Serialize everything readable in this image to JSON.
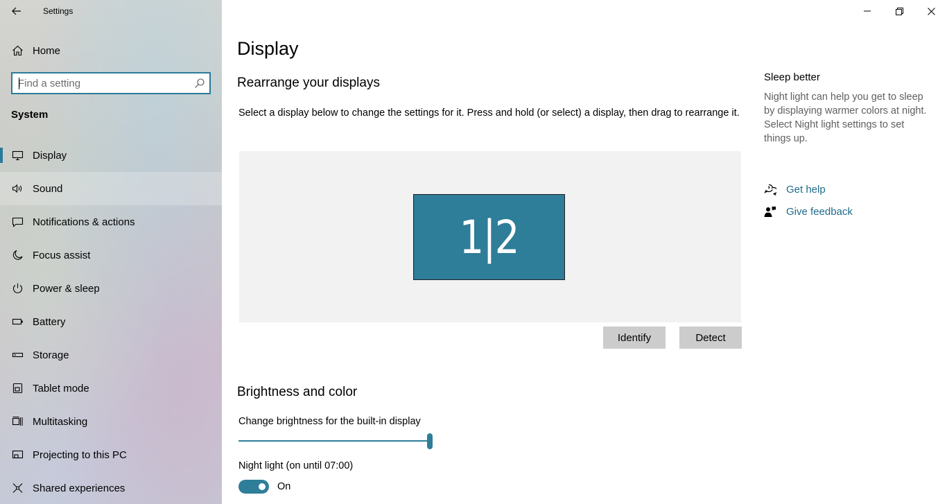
{
  "app": {
    "title": "Settings"
  },
  "sidebar": {
    "home_label": "Home",
    "search_placeholder": "Find a setting",
    "section_title": "System",
    "items": [
      {
        "label": "Display",
        "icon": "monitor-icon"
      },
      {
        "label": "Sound",
        "icon": "speaker-icon"
      },
      {
        "label": "Notifications & actions",
        "icon": "notification-icon"
      },
      {
        "label": "Focus assist",
        "icon": "moon-icon"
      },
      {
        "label": "Power & sleep",
        "icon": "power-icon"
      },
      {
        "label": "Battery",
        "icon": "battery-icon"
      },
      {
        "label": "Storage",
        "icon": "storage-icon"
      },
      {
        "label": "Tablet mode",
        "icon": "tablet-icon"
      },
      {
        "label": "Multitasking",
        "icon": "multitasking-icon"
      },
      {
        "label": "Projecting to this PC",
        "icon": "projecting-icon"
      },
      {
        "label": "Shared experiences",
        "icon": "shared-icon"
      }
    ]
  },
  "main": {
    "title": "Display",
    "rearrange_heading": "Rearrange your displays",
    "rearrange_desc": "Select a display below to change the settings for it. Press and hold (or select) a display, then drag to rearrange it.",
    "monitor_label": "1|2",
    "identify_label": "Identify",
    "detect_label": "Detect",
    "brightness_heading": "Brightness and color",
    "brightness_label": "Change brightness for the built-in display",
    "brightness_value": 100,
    "night_light_label": "Night light (on until 07:00)",
    "night_light_state": "On"
  },
  "aside": {
    "title": "Sleep better",
    "text": "Night light can help you get to sleep by displaying warmer colors at night. Select Night light settings to set things up.",
    "get_help": "Get help",
    "give_feedback": "Give feedback"
  },
  "colors": {
    "accent": "#2e7d99",
    "link": "#1e6b8a",
    "canvas": "#f2f2f2",
    "button": "#cccccc"
  }
}
